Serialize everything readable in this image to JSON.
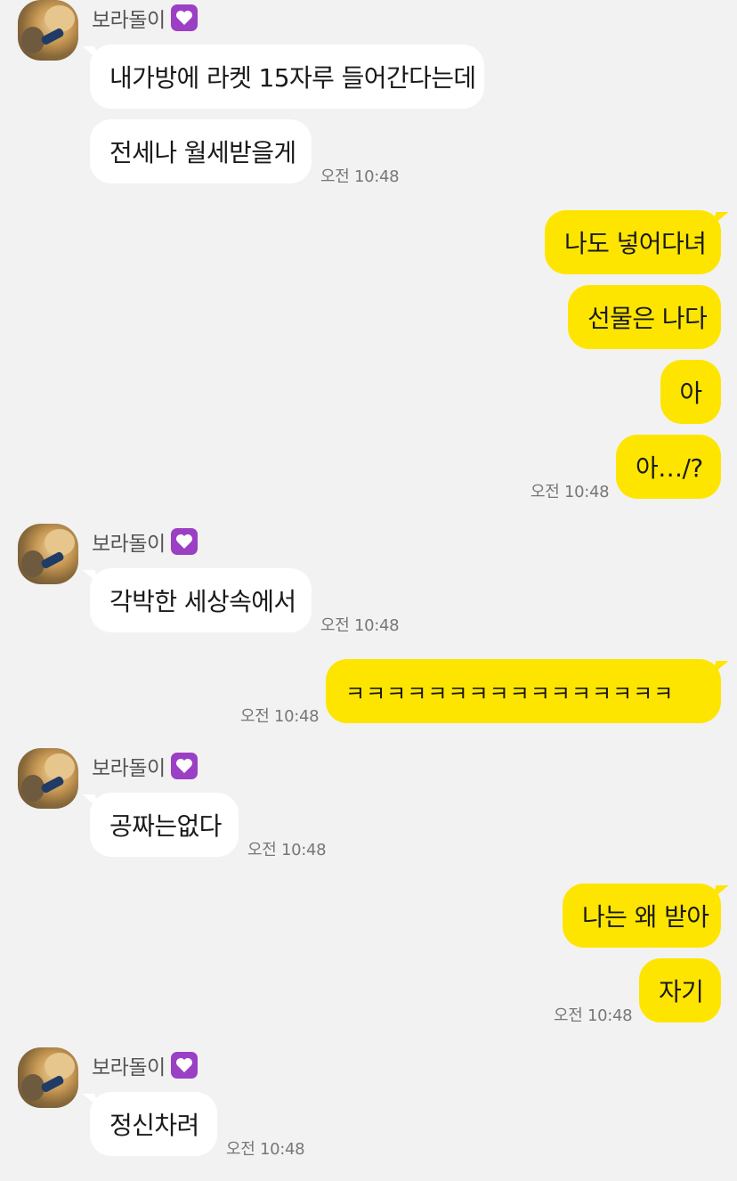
{
  "contact": {
    "name": "보라돌이"
  },
  "messages": {
    "m1": "내가방에 라켓 15자루 들어간다는데",
    "m2": "전세나 월세받을게",
    "m3": "나도 넣어다녀",
    "m4": "선물은 나다",
    "m5": "아",
    "m6": "아…/?",
    "m7": "각박한 세상속에서",
    "m8": "ㅋㅋㅋㅋㅋㅋㅋㅋㅋㅋㅋㅋㅋㅋㅋㅋ",
    "m9": "공짜는없다",
    "m10": "나는 왜 받아",
    "m11": "자기",
    "m12": "정신차려"
  },
  "times": {
    "t1": "오전 10:48",
    "t2": "오전 10:48",
    "t3": "오전 10:48",
    "t4": "오전 10:48",
    "t5": "오전 10:48",
    "t6": "오전 10:48",
    "t7": "오전 10:48"
  },
  "colors": {
    "background": "#f2f2f2",
    "incoming_bubble": "#ffffff",
    "outgoing_bubble": "#fee500",
    "heart_badge": "#9b3fc4"
  },
  "icons": {
    "name_badge": "purple-heart-icon"
  }
}
